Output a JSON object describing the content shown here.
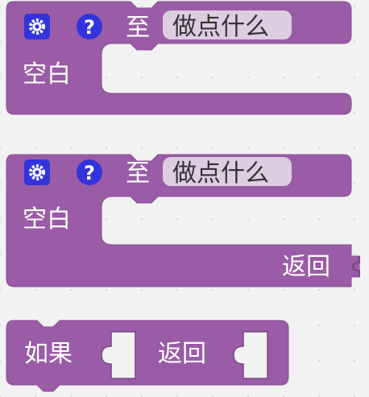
{
  "colors": {
    "block": "#9a5ca6",
    "block_shadow": "#7a4585",
    "field_bg": "#dccde0",
    "icon_bg": "#3333dd",
    "workspace": "#f2f2f2"
  },
  "blocks": [
    {
      "type": "procedure-no-return",
      "mutator_icon": "gear-icon",
      "help_icon": "question-icon",
      "help_glyph": "?",
      "to_label": "至",
      "name_field": "做点什么",
      "body_label": "空白"
    },
    {
      "type": "procedure-with-return",
      "mutator_icon": "gear-icon",
      "help_icon": "question-icon",
      "help_glyph": "?",
      "to_label": "至",
      "name_field": "做点什么",
      "body_label": "空白",
      "return_label": "返回"
    },
    {
      "type": "if-return",
      "if_label": "如果",
      "return_label": "返回"
    }
  ]
}
